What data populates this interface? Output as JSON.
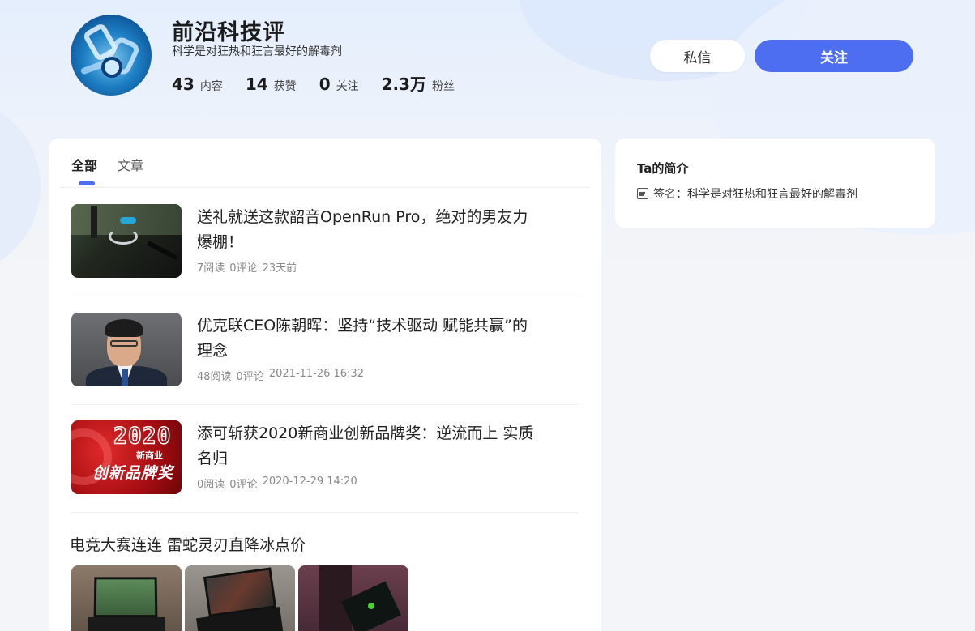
{
  "profile": {
    "name": "前沿科技评",
    "signature": "科学是对狂热和狂言最好的解毒剂",
    "stats": [
      {
        "num": "43",
        "label": "内容"
      },
      {
        "num": "14",
        "label": "获赞"
      },
      {
        "num": "0",
        "label": "关注"
      },
      {
        "num": "2.3万",
        "label": "粉丝"
      }
    ]
  },
  "actions": {
    "message_label": "私信",
    "follow_label": "关注"
  },
  "colors": {
    "accent": "#4e6ef2"
  },
  "tabs": [
    {
      "label": "全部",
      "active": true
    },
    {
      "label": "文章",
      "active": false
    }
  ],
  "articles": [
    {
      "title": "送礼就送这款韶音OpenRun Pro，绝对的男友力爆棚！",
      "reads": "7阅读",
      "comments": "0评论",
      "time": "23天前"
    },
    {
      "title": "优克联CEO陈朝晖：坚持“技术驱动 赋能共赢”的理念",
      "reads": "48阅读",
      "comments": "0评论",
      "time": "2021-11-26 16:32"
    },
    {
      "title": "添可斩获2020新商业创新品牌奖：逆流而上 实质名归",
      "reads": "0阅读",
      "comments": "0评论",
      "time": "2020-12-29 14:20"
    }
  ],
  "thumb3_text": {
    "year": "2020",
    "sub": "新商业",
    "big": "创新品牌奖"
  },
  "gallery_post": {
    "title": "电竞大赛连连 雷蛇灵刃直降冰点价"
  },
  "intro": {
    "title": "Ta的简介",
    "signature_line": "签名：科学是对狂热和狂言最好的解毒剂"
  }
}
